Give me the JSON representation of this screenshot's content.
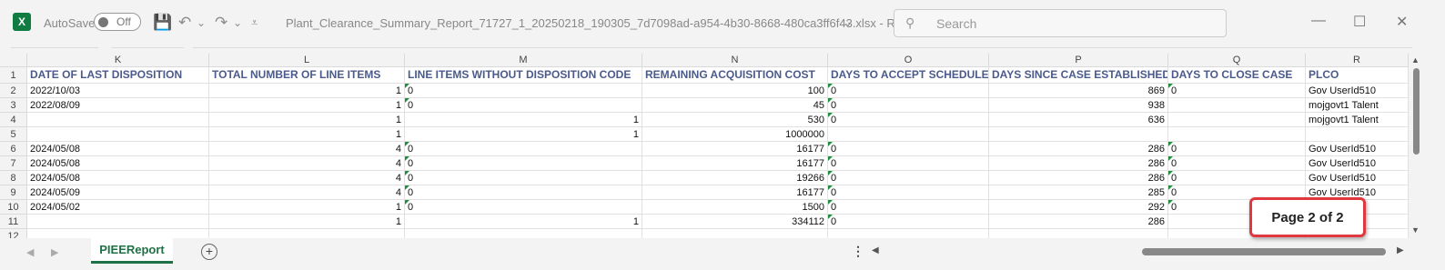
{
  "titlebar": {
    "app_icon": "excel-icon",
    "autosave_label": "AutoSave",
    "autosave_state": "Off",
    "filename": "Plant_Clearance_Summary_Report_71727_1_20250218_190305_7d7098ad-a954-4b30-8668-480ca3ff6f43.xlsx  -  Read-...",
    "search_placeholder": "Search",
    "icons": {
      "save": "💾",
      "undo": "↶",
      "redo": "↷",
      "dropdown": "⌄",
      "customize": "⩡",
      "search": "⚲",
      "minimize": "—",
      "maximize": "☐",
      "close": "✕"
    }
  },
  "grid": {
    "columns": [
      "K",
      "L",
      "M",
      "N",
      "O",
      "P",
      "Q",
      "R"
    ],
    "headers": [
      "DATE OF LAST DISPOSITION",
      "TOTAL NUMBER OF LINE ITEMS",
      "LINE ITEMS WITHOUT DISPOSITION CODE",
      "REMAINING ACQUISITION COST",
      "DAYS TO ACCEPT SCHEDULE",
      "DAYS SINCE CASE ESTABLISHED",
      "DAYS TO CLOSE CASE",
      "PLCO"
    ],
    "row_numbers": [
      "1",
      "2",
      "3",
      "4",
      "5",
      "6",
      "7",
      "8",
      "9",
      "10",
      "11",
      "12"
    ],
    "rows": [
      [
        "2022/10/03",
        "1",
        "0",
        "100",
        "0",
        "869",
        "0",
        "Gov UserId510"
      ],
      [
        "2022/08/09",
        "1",
        "0",
        "45",
        "0",
        "938",
        "",
        "mojgovt1 Talent"
      ],
      [
        "",
        "1",
        "1",
        "530",
        "0",
        "636",
        "",
        "mojgovt1 Talent"
      ],
      [
        "",
        "1",
        "1",
        "1000000",
        "",
        "",
        "",
        ""
      ],
      [
        "2024/05/08",
        "4",
        "0",
        "16177",
        "0",
        "286",
        "0",
        "Gov UserId510"
      ],
      [
        "2024/05/08",
        "4",
        "0",
        "16177",
        "0",
        "286",
        "0",
        "Gov UserId510"
      ],
      [
        "2024/05/08",
        "4",
        "0",
        "19266",
        "0",
        "286",
        "0",
        "Gov UserId510"
      ],
      [
        "2024/05/09",
        "4",
        "0",
        "16177",
        "0",
        "285",
        "0",
        "Gov UserId510"
      ],
      [
        "2024/05/02",
        "1",
        "0",
        "1500",
        "0",
        "292",
        "0",
        "nt"
      ],
      [
        "",
        "1",
        "1",
        "334112",
        "0",
        "286",
        "",
        "0"
      ]
    ]
  },
  "sheets": {
    "active": "PIEEReport",
    "add_label": "+",
    "more": "⋮"
  },
  "badge": {
    "text": "Page 2 of 2"
  },
  "colors": {
    "excel_green": "#107c41",
    "header_text": "#4a5a8c",
    "badge_border": "#e0383e"
  }
}
